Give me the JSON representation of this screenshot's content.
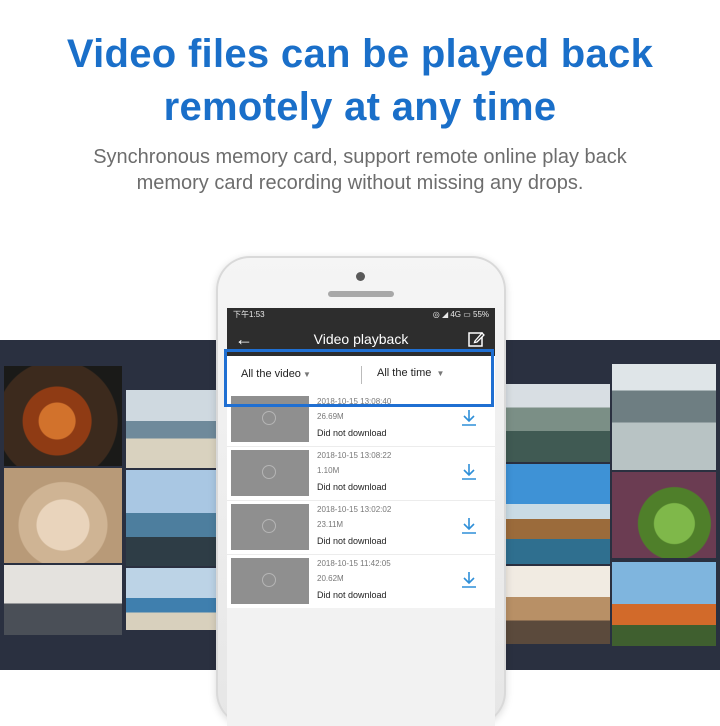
{
  "headline": {
    "line1": "Video files can be played back",
    "line2": "remotely at any time"
  },
  "subline": {
    "line1": "Synchronous memory card, support remote online play back",
    "line2": "memory card recording without missing any drops."
  },
  "phone": {
    "status_time": "下午1:53",
    "status_right": "◎ ◢ 4G ▭ 55%",
    "nav": {
      "back_icon": "arrow-left-icon",
      "title": "Video playback",
      "edit_icon": "edit-icon"
    },
    "filters": {
      "video": "All the video",
      "time": "All the time",
      "caret": "▼"
    },
    "recordings": [
      {
        "date": "2018-10-15 13:08:40",
        "size": "26.69M",
        "status": "Did not download"
      },
      {
        "date": "2018-10-15 13:08:22",
        "size": "1.10M",
        "status": "Did not download"
      },
      {
        "date": "2018-10-15 13:02:02",
        "size": "23.11M",
        "status": "Did not download"
      },
      {
        "date": "2018-10-15 11:42:05",
        "size": "20.62M",
        "status": "Did not download"
      }
    ]
  },
  "colors": {
    "accent": "#1a6fc9",
    "highlight": "#1f6fd2",
    "download": "#2f8fd8"
  }
}
